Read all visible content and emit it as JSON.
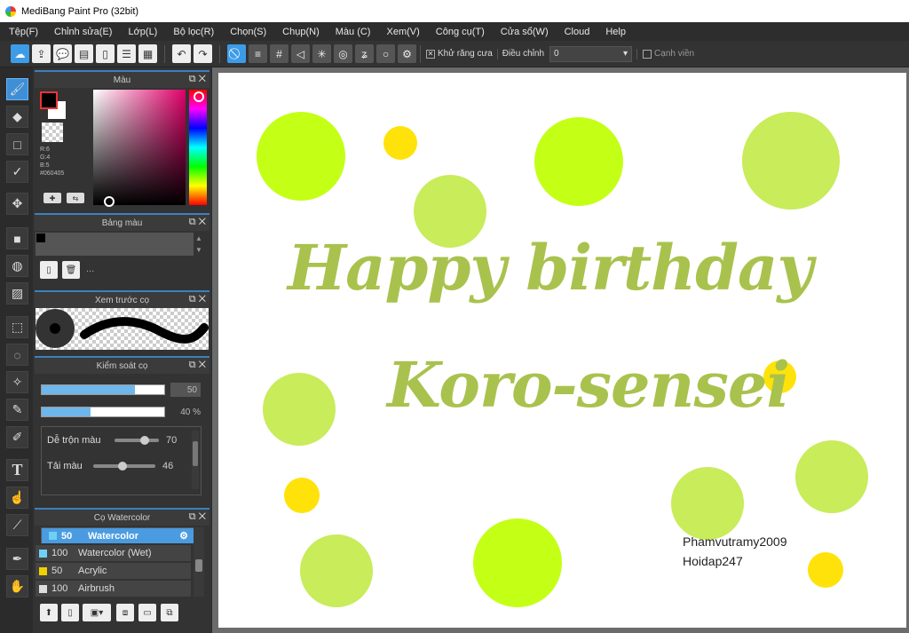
{
  "window": {
    "title": "MediBang Paint Pro (32bit)"
  },
  "menu": {
    "items": [
      "Tệp(F)",
      "Chỉnh sửa(E)",
      "Lớp(L)",
      "Bộ lọc(R)",
      "Chọn(S)",
      "Chụp(N)",
      "Màu (C)",
      "Xem(V)",
      "Công cụ(T)",
      "Cửa sổ(W)",
      "Cloud",
      "Help"
    ]
  },
  "toolbar": {
    "antialias_label": "Khử răng cưa",
    "adjust_label": "Điều chỉnh",
    "adjust_value": "0",
    "edge_label": "Cạnh viền"
  },
  "color_panel": {
    "title": "Màu",
    "r": "R:6",
    "g": "G:4",
    "b": "B:5",
    "hex": "#060405"
  },
  "palette_panel": {
    "title": "Bảng màu",
    "more": "..."
  },
  "brush_preview_panel": {
    "title": "Xem trước cọ"
  },
  "brush_control_panel": {
    "title": "Kiểm soát cọ",
    "size_value": "50",
    "opacity_value": "40 %",
    "size_fill": 0.76,
    "opacity_fill": 0.4,
    "blend_label": "Dễ trộn màu",
    "blend_value": "70",
    "reload_label": "Tải màu",
    "reload_value": "46"
  },
  "brush_list_panel": {
    "title": "Cọ Watercolor",
    "brushes": [
      {
        "size": "50",
        "name": "Watercolor",
        "color": "#6fd0f5"
      },
      {
        "size": "100",
        "name": "Watercolor (Wet)",
        "color": "#6fd0f5"
      },
      {
        "size": "50",
        "name": "Acrylic",
        "color": "#f0d000"
      },
      {
        "size": "100",
        "name": "Airbrush",
        "color": "#dddddd"
      }
    ]
  },
  "canvas": {
    "line1": "Happy birthday",
    "line2": "Koro-sensei",
    "signature1": "Phamvutramy2009",
    "signature2": "Hoidap247",
    "colors": {
      "lime": "#c4ff16",
      "light_green": "#c8ec5a",
      "yellow": "#ffe20a",
      "text": "#a9c24d"
    }
  }
}
